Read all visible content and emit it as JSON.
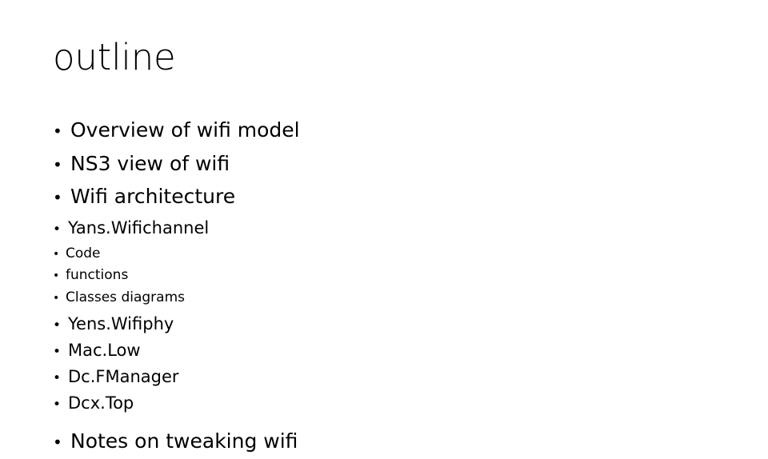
{
  "slide": {
    "title": "outline",
    "background_color": "#ffffff",
    "text_color": "#000000",
    "bullet_glyph": "•"
  },
  "outline": {
    "items": [
      {
        "label": "Overview of wifi model",
        "level": 1
      },
      {
        "label": "NS3 view of wifi",
        "level": 1
      },
      {
        "label": "Wifi architecture",
        "level": 1
      },
      {
        "label": "Yans.Wifichannel",
        "level": 2
      },
      {
        "label": "Code",
        "level": 3
      },
      {
        "label": "functions",
        "level": 3
      },
      {
        "label": "Classes diagrams",
        "level": 3
      },
      {
        "label": "Yens.Wifiphy",
        "level": 2
      },
      {
        "label": "Mac.Low",
        "level": 2
      },
      {
        "label": "Dc.FManager",
        "level": 2
      },
      {
        "label": "Dcx.Top",
        "level": 2
      },
      {
        "label": "Notes on tweaking wifi",
        "level": 1
      }
    ]
  }
}
